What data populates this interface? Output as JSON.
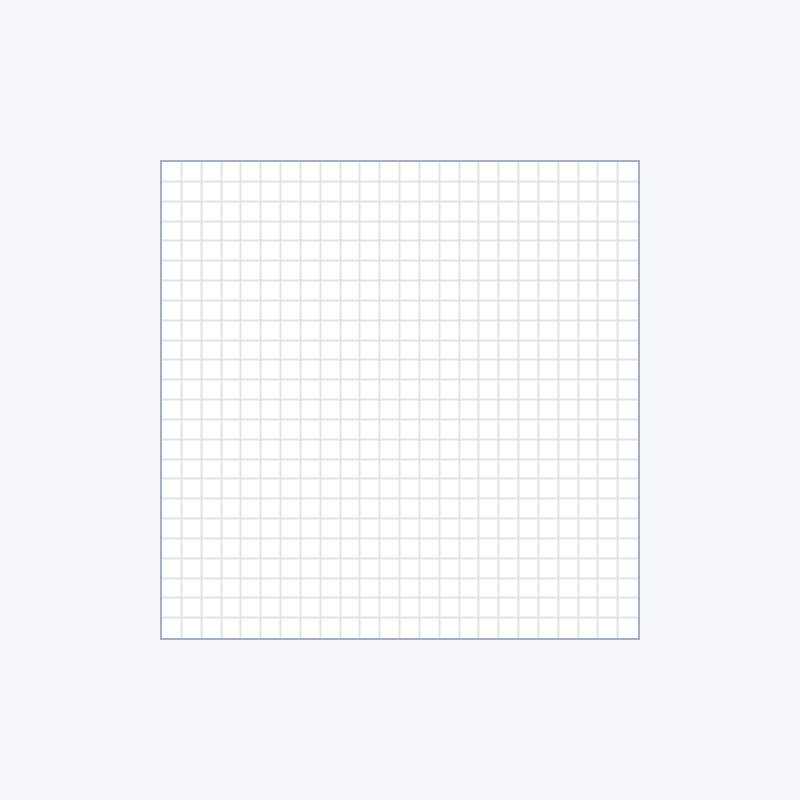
{
  "canvas": {
    "grid_columns": 24,
    "grid_rows": 24,
    "grid_visible": true,
    "background_color": "#ffffff",
    "grid_line_color": "#e0e3e8",
    "border_color": "#a3aec0",
    "page_background_color": "#f5f7fa"
  }
}
